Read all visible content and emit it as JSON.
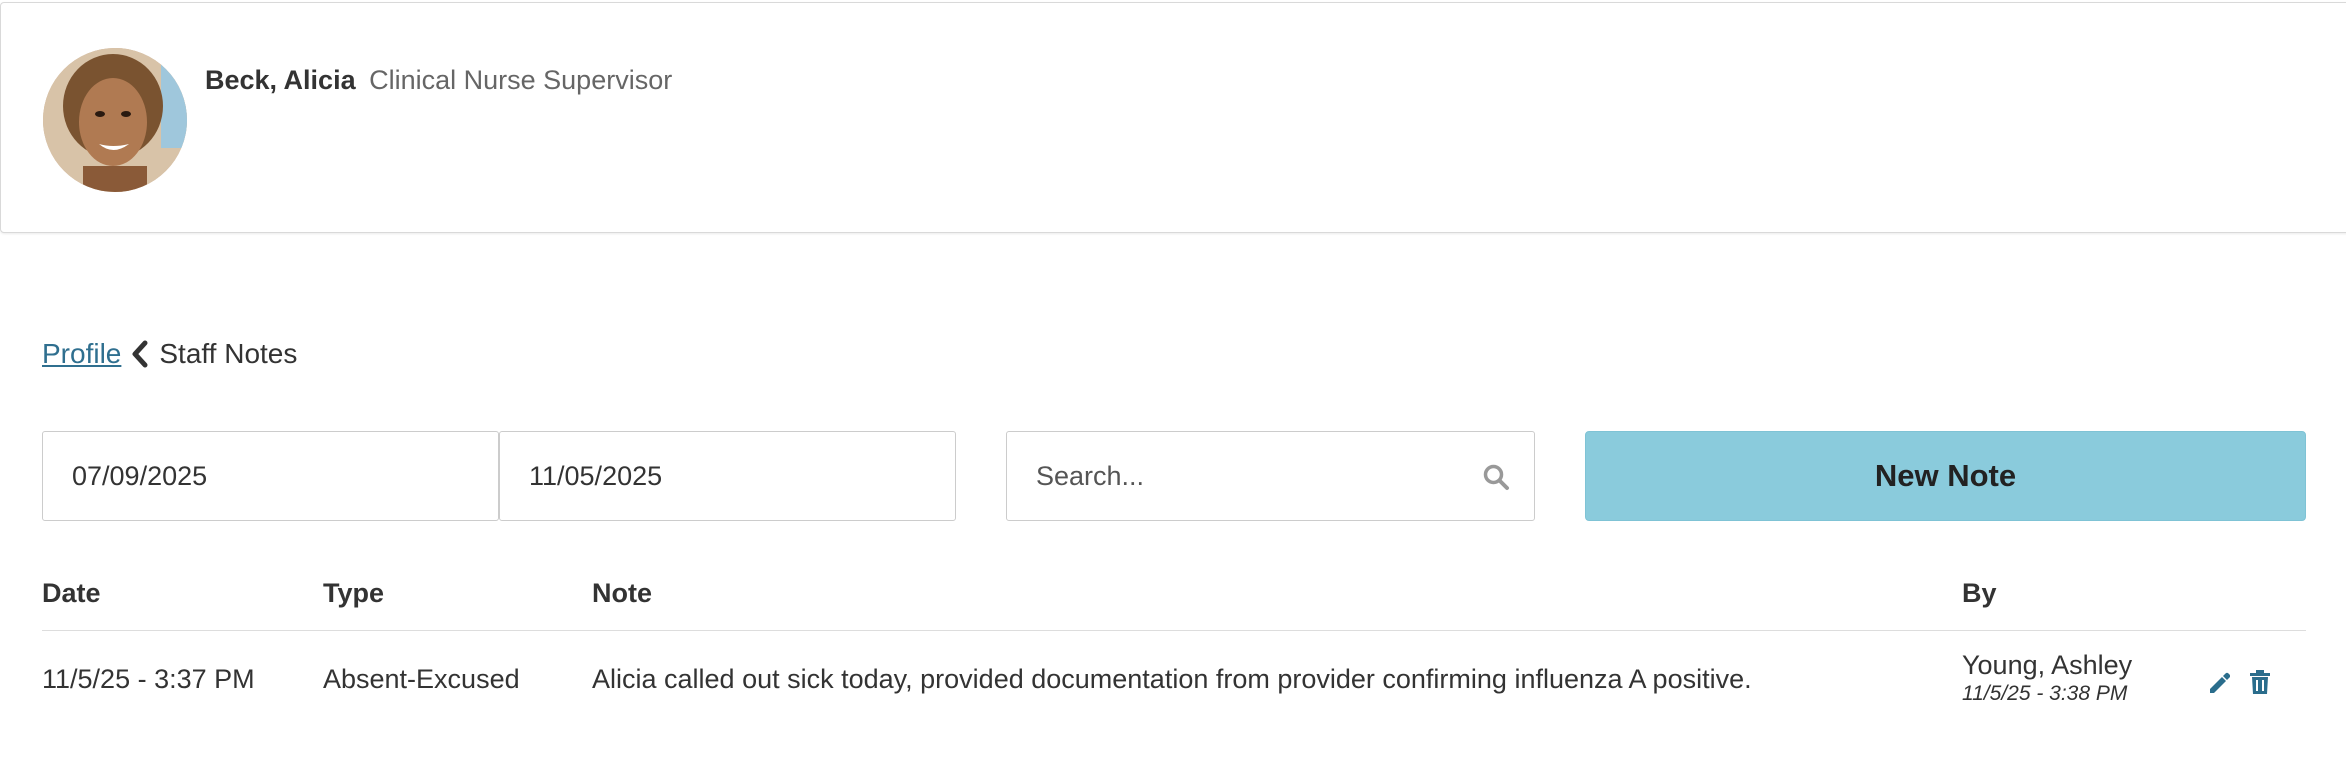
{
  "staff": {
    "name": "Beck, Alicia",
    "title": "Clinical Nurse Supervisor"
  },
  "breadcrumb": {
    "parent": "Profile",
    "current": "Staff Notes"
  },
  "filters": {
    "date_from": "07/09/2025",
    "date_to": "11/05/2025",
    "search_placeholder": "Search...",
    "new_note_label": "New Note"
  },
  "table": {
    "headers": {
      "date": "Date",
      "type": "Type",
      "note": "Note",
      "by": "By"
    },
    "rows": [
      {
        "date": "11/5/25 - 3:37 PM",
        "type": "Absent-Excused",
        "note": "Alicia called out sick today, provided documentation from provider confirming influenza A positive.",
        "by_name": "Young, Ashley",
        "by_time": "11/5/25 - 3:38 PM"
      }
    ]
  },
  "icons": {
    "chevron": "chevron-left-icon",
    "search": "search-icon",
    "edit": "pencil-icon",
    "delete": "trash-icon"
  },
  "colors": {
    "accent": "#8acbdc",
    "link": "#2f6f8f",
    "action_icon": "#2a6d8c"
  }
}
